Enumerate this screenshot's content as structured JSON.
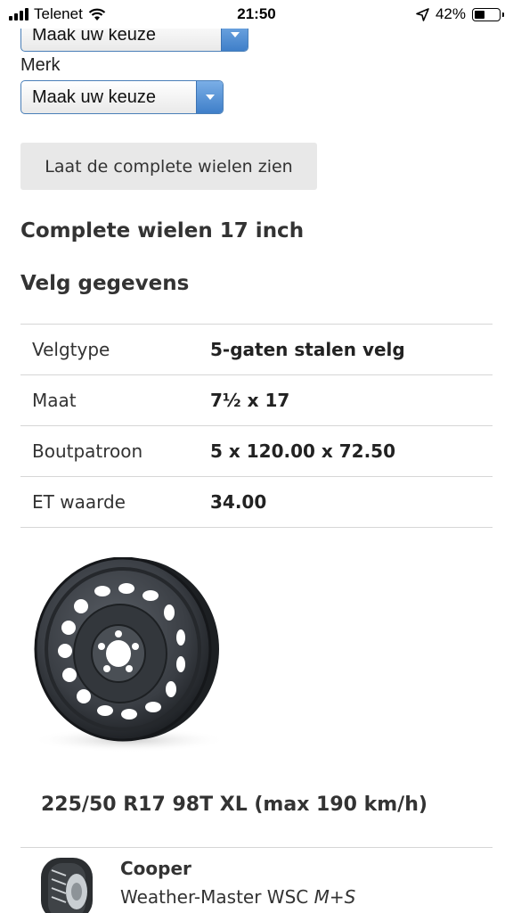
{
  "status_bar": {
    "carrier": "Telenet",
    "time": "21:50",
    "battery_percent": "42%",
    "battery_level": 0.42
  },
  "top_select": {
    "value": "Maak uw keuze"
  },
  "merk": {
    "label": "Merk",
    "select_value": "Maak uw keuze"
  },
  "show_wheels_button": "Laat de complete wielen zien",
  "heading_complete": "Complete wielen 17 inch",
  "heading_velg": "Velg gegevens",
  "specs": [
    {
      "key": "Velgtype",
      "value": "5-gaten stalen velg"
    },
    {
      "key": "Maat",
      "value": "7½ x 17"
    },
    {
      "key": "Boutpatroon",
      "value": "5 x 120.00 x 72.50"
    },
    {
      "key": "ET waarde",
      "value": "34.00"
    }
  ],
  "tire": {
    "size": "225/50 R17 98T XL (max 190 km/h)",
    "brand": "Cooper",
    "model": "Weather-Master WSC",
    "model_suffix": "M+S"
  },
  "icons": {
    "signal": "cellular-signal-icon",
    "wifi": "wifi-icon",
    "location": "location-arrow-icon",
    "battery": "battery-icon",
    "dropdown": "chevron-down-icon"
  },
  "colors": {
    "select_border": "#4a7fb8",
    "select_arrow": "#3f7fc9",
    "button_bg": "#e8e8e8",
    "divider": "#d6d6d6"
  }
}
